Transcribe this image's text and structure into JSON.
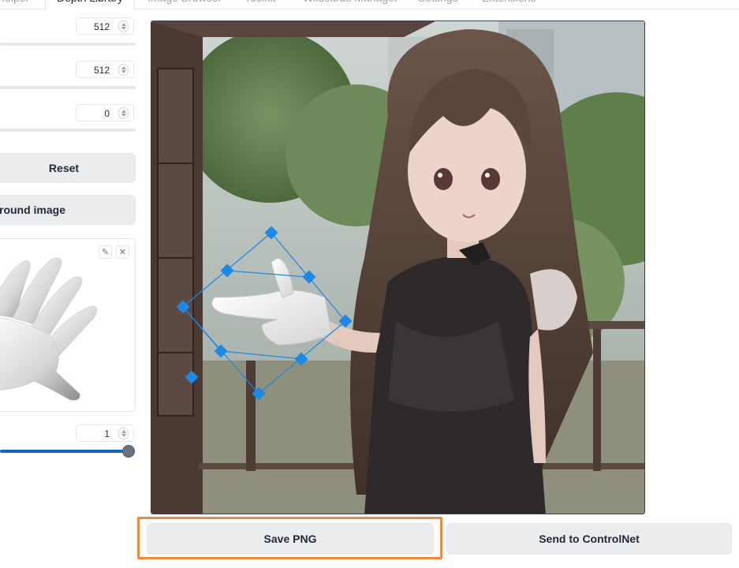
{
  "tabs": {
    "items": [
      {
        "label": "Helper",
        "active": false
      },
      {
        "label": "Depth Library",
        "active": true
      },
      {
        "label": "Image Browser",
        "active": false
      },
      {
        "label": "Toolkit",
        "active": false
      },
      {
        "label": "Wildcards Manager",
        "active": false
      },
      {
        "label": "Settings",
        "active": false
      },
      {
        "label": "Extensions",
        "active": false
      }
    ]
  },
  "settings": {
    "width": {
      "value": "512",
      "progress": 1.0
    },
    "height": {
      "value": "512",
      "progress": 1.0
    },
    "third": {
      "value": "0",
      "progress": 0.0
    },
    "reset_label": "Reset",
    "background_label": "round image",
    "opacity": {
      "value": "1",
      "progress": 1.0
    }
  },
  "preview": {
    "edit_icon": "pencil-icon",
    "close_icon": "close-icon",
    "edit_glyph": "✎",
    "close_glyph": "✕"
  },
  "canvas": {
    "hand_handles_color": "#1e88e5"
  },
  "actions": {
    "save_label": "Save PNG",
    "send_label": "Send to ControlNet",
    "highlight_color": "#f0883e"
  }
}
